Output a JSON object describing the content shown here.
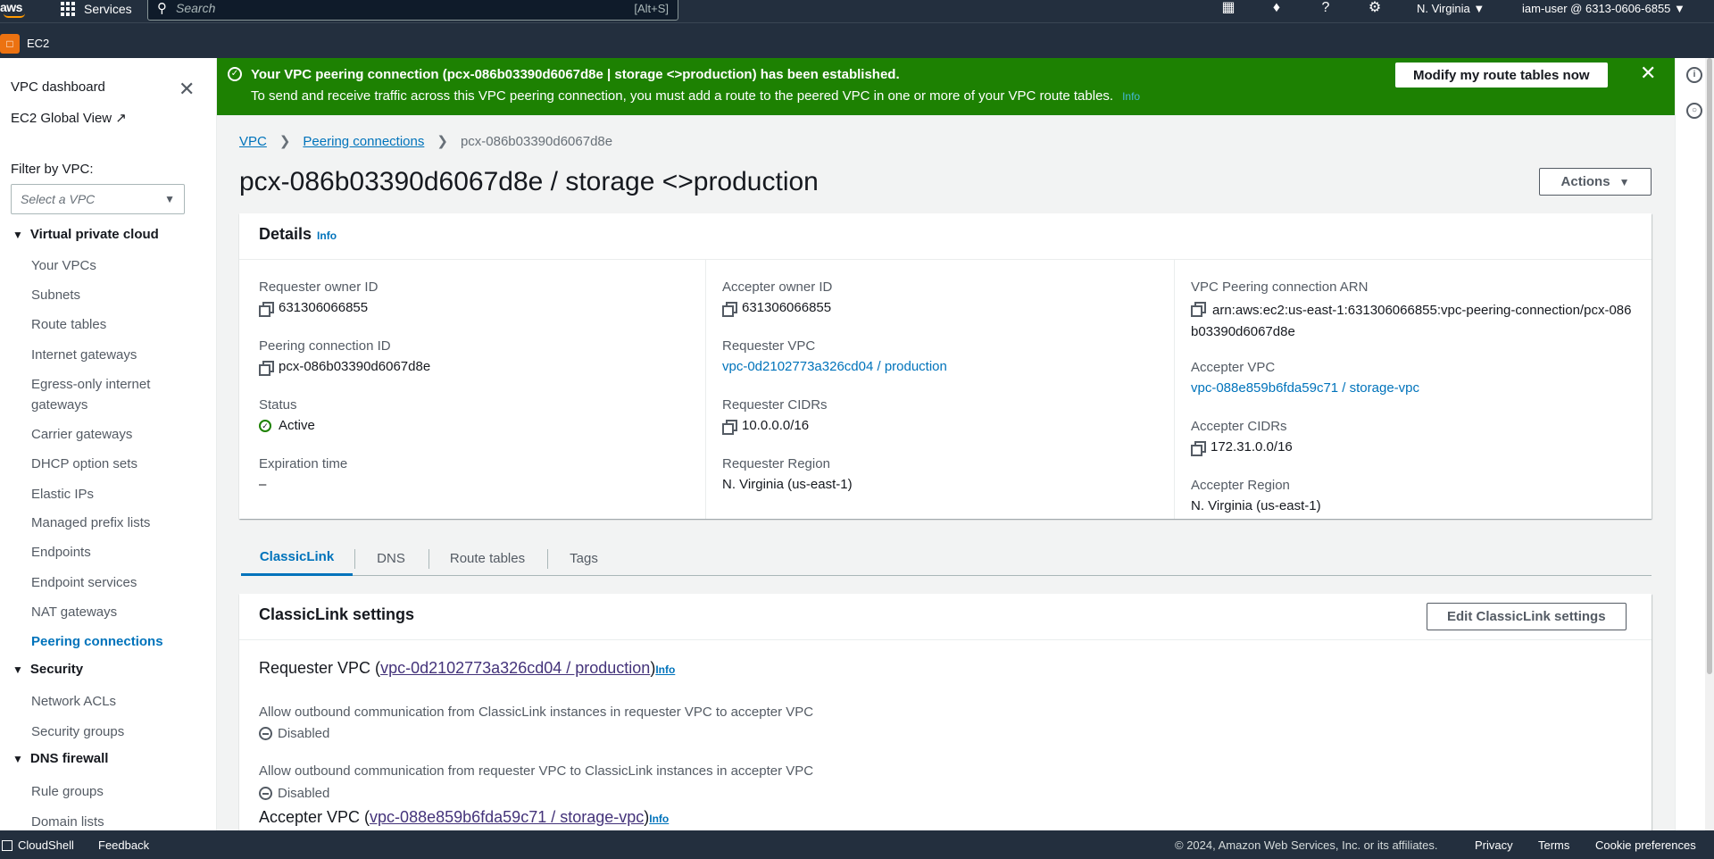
{
  "topnav": {
    "logo": "aws",
    "services_label": "Services",
    "search_placeholder": "Search",
    "search_shortcut": "[Alt+S]",
    "region": "N. Virginia ▼",
    "account": "iam-user @ 6313-0606-6855 ▼"
  },
  "subbar": {
    "service_name": "EC2"
  },
  "sidebar": {
    "dashboard": "VPC dashboard",
    "global_view": "EC2 Global View",
    "filter_label": "Filter by VPC:",
    "filter_placeholder": "Select a VPC",
    "sections": [
      {
        "title": "Virtual private cloud",
        "items": [
          "Your VPCs",
          "Subnets",
          "Route tables",
          "Internet gateways",
          "Egress-only internet gateways",
          "Carrier gateways",
          "DHCP option sets",
          "Elastic IPs",
          "Managed prefix lists",
          "Endpoints",
          "Endpoint services",
          "NAT gateways",
          "Peering connections"
        ]
      },
      {
        "title": "Security",
        "items": [
          "Network ACLs",
          "Security groups"
        ]
      },
      {
        "title": "DNS firewall",
        "items": [
          "Rule groups",
          "Domain lists"
        ]
      }
    ],
    "active_item": "Peering connections"
  },
  "flash": {
    "title": "Your VPC peering connection (pcx-086b03390d6067d8e | storage <>production) has been established.",
    "message": "To send and receive traffic across this VPC peering connection, you must add a route to the peered VPC in one or more of your VPC route tables.",
    "more": "Info",
    "button": "Modify my route tables now",
    "color": "#1d8102"
  },
  "breadcrumb": {
    "root": "VPC",
    "parent": "Peering connections",
    "current": "pcx-086b03390d6067d8e"
  },
  "page_title": "pcx-086b03390d6067d8e / storage <>production",
  "actions_label": "Actions",
  "details": {
    "heading": "Details",
    "info": "Info",
    "requester_owner_id_label": "Requester owner ID",
    "requester_owner_id": "631306066855",
    "peering_id_label": "Peering connection ID",
    "peering_id": "pcx-086b03390d6067d8e",
    "status_label": "Status",
    "status": "Active",
    "expiration_label": "Expiration time",
    "expiration": "–",
    "accepter_owner_id_label": "Accepter owner ID",
    "accepter_owner_id": "631306066855",
    "requester_vpc_label": "Requester VPC",
    "requester_vpc": "vpc-0d2102773a326cd04 / production",
    "requester_cidrs_label": "Requester CIDRs",
    "requester_cidrs": "10.0.0.0/16",
    "requester_region_label": "Requester Region",
    "requester_region": "N. Virginia (us-east-1)",
    "arn_label": "VPC Peering connection ARN",
    "arn": "arn:aws:ec2:us-east-1:631306066855:vpc-peering-connection/pcx-086b03390d6067d8e",
    "accepter_vpc_label": "Accepter VPC",
    "accepter_vpc": "vpc-088e859b6fda59c71 / storage-vpc",
    "accepter_cidrs_label": "Accepter CIDRs",
    "accepter_cidrs": "172.31.0.0/16",
    "accepter_region_label": "Accepter Region",
    "accepter_region": "N. Virginia (us-east-1)"
  },
  "tabs": [
    {
      "label": "ClassicLink",
      "active": true
    },
    {
      "label": "DNS",
      "active": false
    },
    {
      "label": "Route tables",
      "active": false
    },
    {
      "label": "Tags",
      "active": false
    }
  ],
  "classiclink": {
    "heading": "ClassicLink settings",
    "edit_button": "Edit ClassicLink settings",
    "requester_prefix": "Requester VPC (",
    "requester_vpc": "vpc-0d2102773a326cd04 / production",
    "suffix": ")",
    "info": "Info",
    "allow1_label": "Allow outbound communication from ClassicLink instances in requester VPC to accepter VPC",
    "allow1_value": "Disabled",
    "allow2_label": "Allow outbound communication from requester VPC to ClassicLink instances in accepter VPC",
    "allow2_value": "Disabled",
    "accepter_prefix": "Accepter VPC (",
    "accepter_vpc": "vpc-088e859b6fda59c71 / storage-vpc"
  },
  "footer": {
    "cloudshell": "CloudShell",
    "feedback": "Feedback",
    "copyright": "© 2024, Amazon Web Services, Inc. or its affiliates.",
    "privacy": "Privacy",
    "terms": "Terms",
    "cookies": "Cookie preferences"
  }
}
